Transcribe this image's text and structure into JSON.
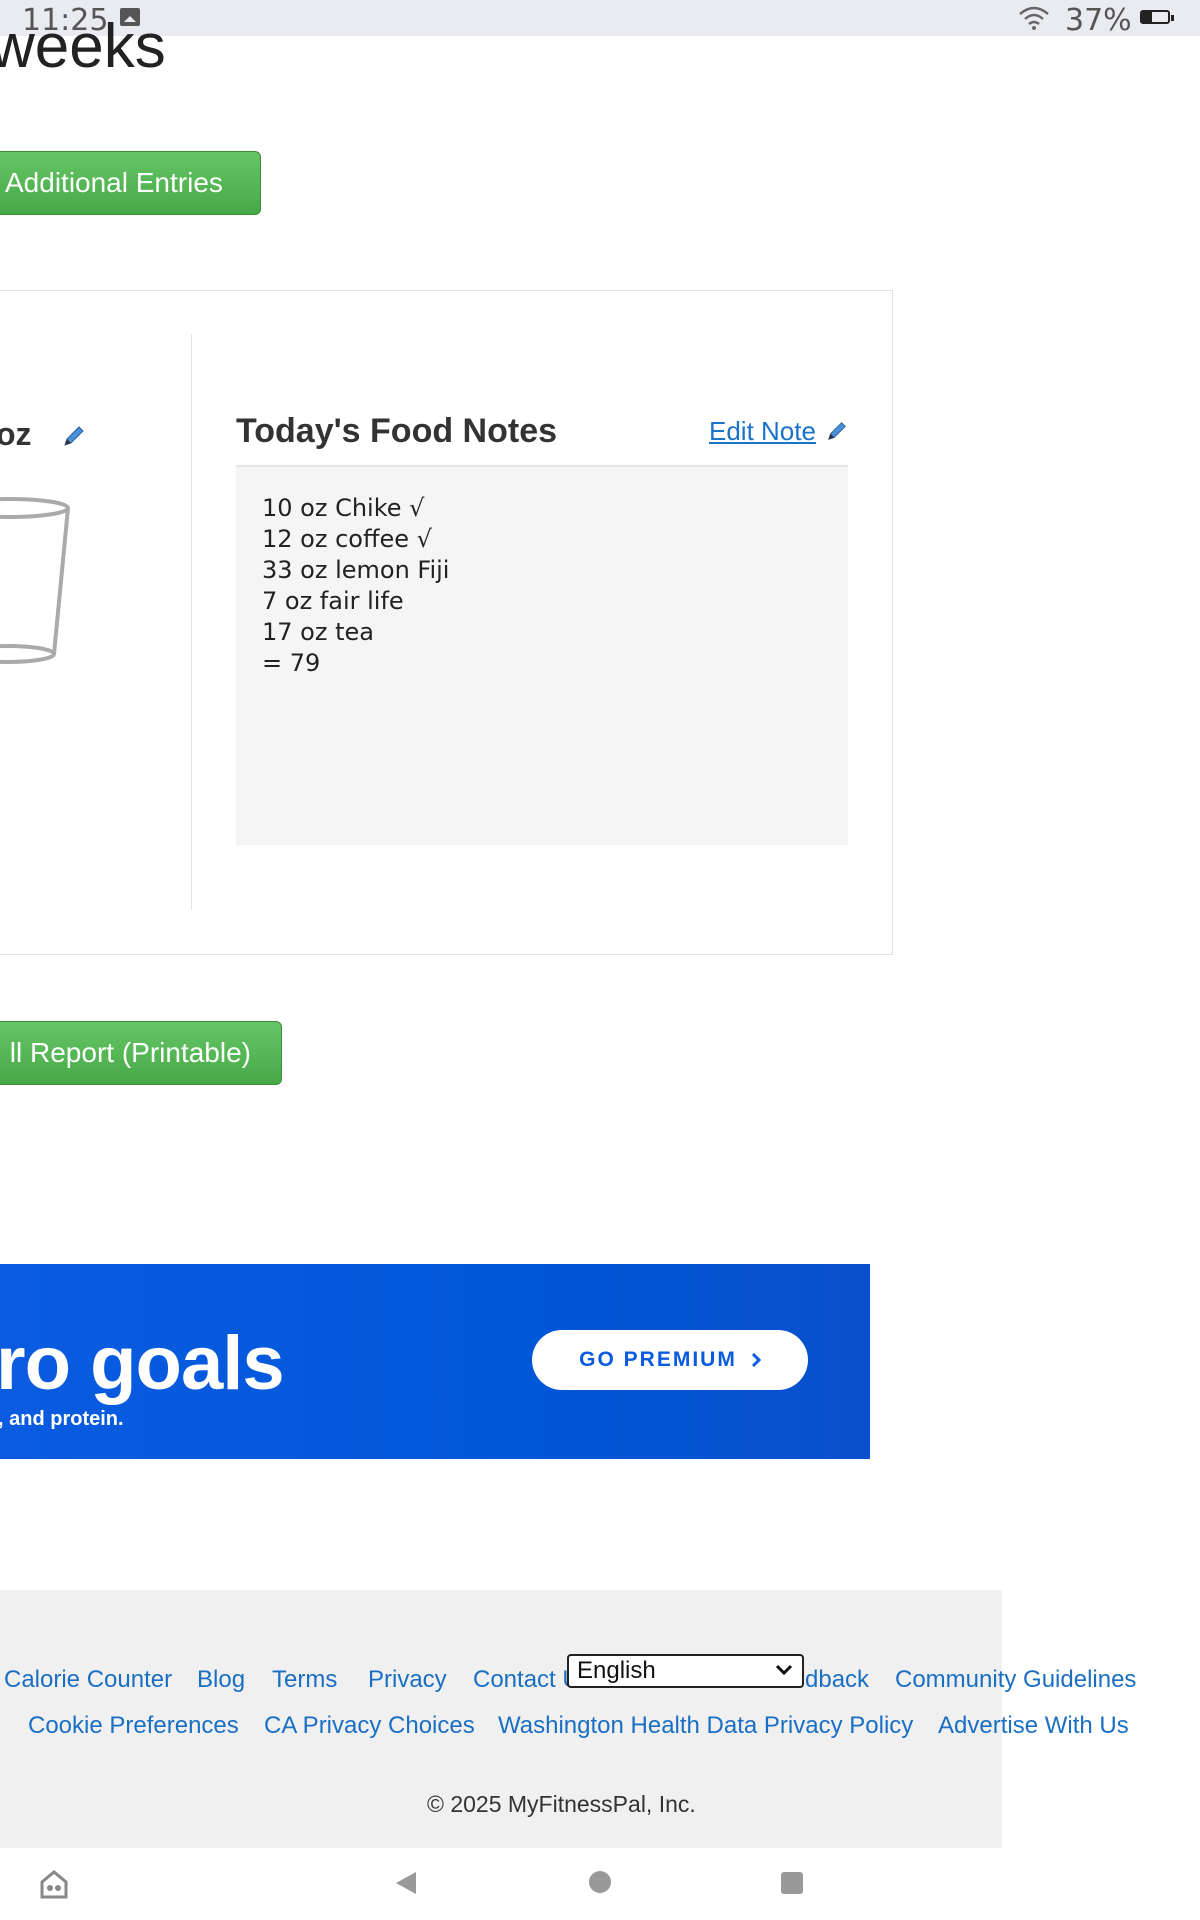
{
  "status_bar": {
    "time": "11:25",
    "battery": "37%"
  },
  "page": {
    "heading": "weeks"
  },
  "buttons": {
    "additional_entries": "Additional Entries",
    "full_report": "ll Report (Printable)"
  },
  "water": {
    "amount": "oz"
  },
  "food_notes": {
    "title": "Today's Food Notes",
    "edit_label": "Edit Note",
    "lines": [
      "10 oz Chike √",
      "12 oz coffee √",
      "33 oz lemon Fiji",
      "7 oz fair life",
      "17 oz tea",
      "= 79"
    ]
  },
  "banner": {
    "title": "ro goals",
    "subtitle": ", and protein.",
    "cta": "GO PREMIUM"
  },
  "footer": {
    "links_row1": [
      "Calorie Counter",
      "Blog",
      "Terms",
      "Privacy",
      "Contact U",
      "dback",
      "Community Guidelines"
    ],
    "links_row2": [
      "Cookie Preferences",
      "CA Privacy Choices",
      "Washington Health Data Privacy Policy",
      "Advertise With Us"
    ],
    "language": "English",
    "copyright": "© 2025 MyFitnessPal, Inc."
  },
  "colors": {
    "green": "#4cae4c",
    "link": "#1a6fc4",
    "banner": "#0057d8"
  }
}
